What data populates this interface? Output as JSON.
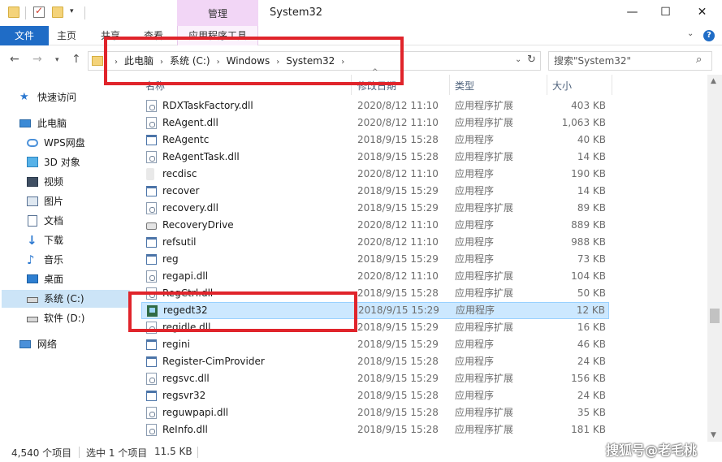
{
  "titlebar": {
    "context_tab": "管理",
    "title": "System32",
    "min": "—",
    "max": "☐",
    "close": "✕",
    "qa_dropdown": "▾"
  },
  "ribbon": {
    "tabs": [
      "文件",
      "主页",
      "共享",
      "查看",
      "应用程序工具"
    ],
    "expand": "⌄",
    "help": "?"
  },
  "address": {
    "back": "←",
    "forward": "→",
    "recent": "▾",
    "up": "↑",
    "crumbs": [
      "此电脑",
      "系统 (C:)",
      "Windows",
      "System32"
    ],
    "crumb_sep": "›",
    "dropdown": "⌄",
    "refresh": "↻"
  },
  "search": {
    "placeholder": "搜索\"System32\"",
    "icon": "⌕"
  },
  "navpane": {
    "items": [
      {
        "label": "快速访问",
        "icon": "star-icon"
      },
      {
        "label": "此电脑",
        "icon": "computer-icon"
      },
      {
        "label": "WPS网盘",
        "icon": "cloud-icon"
      },
      {
        "label": "3D 对象",
        "icon": "cube-icon"
      },
      {
        "label": "视频",
        "icon": "video-icon"
      },
      {
        "label": "图片",
        "icon": "picture-icon"
      },
      {
        "label": "文档",
        "icon": "document-icon"
      },
      {
        "label": "下载",
        "icon": "download-icon"
      },
      {
        "label": "音乐",
        "icon": "music-icon"
      },
      {
        "label": "桌面",
        "icon": "desktop-icon"
      },
      {
        "label": "系统 (C:)",
        "icon": "drive-c-icon"
      },
      {
        "label": "软件 (D:)",
        "icon": "drive-d-icon"
      },
      {
        "label": "网络",
        "icon": "network-icon"
      }
    ]
  },
  "columns": {
    "name": "名称",
    "date": "修改日期",
    "type": "类型",
    "size": "大小",
    "sort_arrow": "^"
  },
  "files": [
    {
      "name": "RDXTaskFactory.dll",
      "date": "2020/8/12 11:10",
      "type": "应用程序扩展",
      "size": "403 KB",
      "icon": "dll"
    },
    {
      "name": "ReAgent.dll",
      "date": "2020/8/12 11:10",
      "type": "应用程序扩展",
      "size": "1,063 KB",
      "icon": "dll"
    },
    {
      "name": "ReAgentc",
      "date": "2018/9/15 15:28",
      "type": "应用程序",
      "size": "40 KB",
      "icon": "exe"
    },
    {
      "name": "ReAgentTask.dll",
      "date": "2018/9/15 15:28",
      "type": "应用程序扩展",
      "size": "14 KB",
      "icon": "dll"
    },
    {
      "name": "recdisc",
      "date": "2020/8/12 11:10",
      "type": "应用程序",
      "size": "190 KB",
      "icon": "disc"
    },
    {
      "name": "recover",
      "date": "2018/9/15 15:29",
      "type": "应用程序",
      "size": "14 KB",
      "icon": "exe"
    },
    {
      "name": "recovery.dll",
      "date": "2018/9/15 15:29",
      "type": "应用程序扩展",
      "size": "89 KB",
      "icon": "dll"
    },
    {
      "name": "RecoveryDrive",
      "date": "2020/8/12 11:10",
      "type": "应用程序",
      "size": "889 KB",
      "icon": "drive"
    },
    {
      "name": "refsutil",
      "date": "2020/8/12 11:10",
      "type": "应用程序",
      "size": "988 KB",
      "icon": "exe"
    },
    {
      "name": "reg",
      "date": "2018/9/15 15:29",
      "type": "应用程序",
      "size": "73 KB",
      "icon": "exe"
    },
    {
      "name": "regapi.dll",
      "date": "2020/8/12 11:10",
      "type": "应用程序扩展",
      "size": "104 KB",
      "icon": "dll"
    },
    {
      "name": "RegCtrl.dll",
      "date": "2018/9/15 15:28",
      "type": "应用程序扩展",
      "size": "50 KB",
      "icon": "dll"
    },
    {
      "name": "regedt32",
      "date": "2018/9/15 15:29",
      "type": "应用程序",
      "size": "12 KB",
      "icon": "app",
      "selected": true
    },
    {
      "name": "regidle.dll",
      "date": "2018/9/15 15:29",
      "type": "应用程序扩展",
      "size": "16 KB",
      "icon": "dll"
    },
    {
      "name": "regini",
      "date": "2018/9/15 15:29",
      "type": "应用程序",
      "size": "46 KB",
      "icon": "exe"
    },
    {
      "name": "Register-CimProvider",
      "date": "2018/9/15 15:28",
      "type": "应用程序",
      "size": "24 KB",
      "icon": "exe"
    },
    {
      "name": "regsvc.dll",
      "date": "2018/9/15 15:29",
      "type": "应用程序扩展",
      "size": "156 KB",
      "icon": "dll"
    },
    {
      "name": "regsvr32",
      "date": "2018/9/15 15:28",
      "type": "应用程序",
      "size": "24 KB",
      "icon": "exe"
    },
    {
      "name": "reguwpapi.dll",
      "date": "2018/9/15 15:28",
      "type": "应用程序扩展",
      "size": "35 KB",
      "icon": "dll"
    },
    {
      "name": "ReInfo.dll",
      "date": "2018/9/15 15:28",
      "type": "应用程序扩展",
      "size": "181 KB",
      "icon": "dll"
    }
  ],
  "scrollbar": {
    "up": "▲",
    "down": "▼"
  },
  "status": {
    "count": "4,540 个项目",
    "selected": "选中 1 个项目",
    "size": "11.5 KB"
  },
  "watermark": "搜狐号@老毛桃",
  "colors": {
    "accent": "#1f6cc6",
    "context_tab": "#f2d6f6",
    "selection": "#cce8ff",
    "annotation": "#e0242b"
  }
}
